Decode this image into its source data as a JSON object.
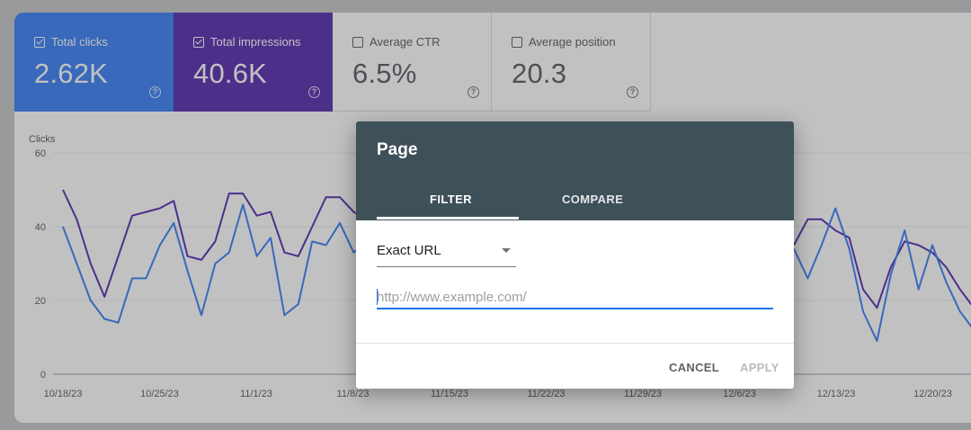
{
  "metrics": [
    {
      "label": "Total clicks",
      "value": "2.62K",
      "checked": true
    },
    {
      "label": "Total impressions",
      "value": "40.6K",
      "checked": true
    },
    {
      "label": "Average CTR",
      "value": "6.5%",
      "checked": false
    },
    {
      "label": "Average position",
      "value": "20.3",
      "checked": false
    }
  ],
  "chart_data": {
    "type": "line",
    "ylabel": "Clicks",
    "ylim": [
      0,
      60
    ],
    "yticks": [
      "0",
      "20",
      "40",
      "60"
    ],
    "xticks": [
      "10/18/23",
      "10/25/23",
      "11/1/23",
      "11/8/23",
      "11/15/23",
      "11/22/23",
      "11/29/23",
      "12/6/23",
      "12/13/23",
      "12/20/23"
    ],
    "grid": true,
    "series": [
      {
        "color": "#5e35b1",
        "values": [
          50,
          42,
          30,
          21,
          32,
          43,
          44,
          45,
          47,
          32,
          31,
          36,
          49,
          49,
          43,
          44,
          33,
          32,
          40,
          48,
          48,
          44,
          42
        ]
      },
      {
        "color": "#4285f4",
        "values": [
          40,
          30,
          20,
          15,
          14,
          26,
          26,
          35,
          41,
          28,
          16,
          30,
          33,
          46,
          32,
          37,
          16,
          19,
          36,
          35,
          41,
          33,
          36
        ]
      },
      {
        "color": "#5e35b1",
        "values": [
          35,
          42,
          42,
          39,
          37,
          23,
          18,
          29,
          36,
          35,
          33,
          29,
          23,
          18,
          12
        ]
      },
      {
        "color": "#4285f4",
        "values": [
          34,
          26,
          35,
          45,
          34,
          17,
          9,
          27,
          39,
          23,
          35,
          25,
          17,
          12,
          11
        ]
      }
    ]
  },
  "dialog": {
    "title": "Page",
    "tab_filter": "FILTER",
    "tab_compare": "COMPARE",
    "match_type": "Exact URL",
    "url_placeholder": "http://www.example.com/",
    "url_value": "",
    "cancel": "CANCEL",
    "apply": "APPLY"
  }
}
